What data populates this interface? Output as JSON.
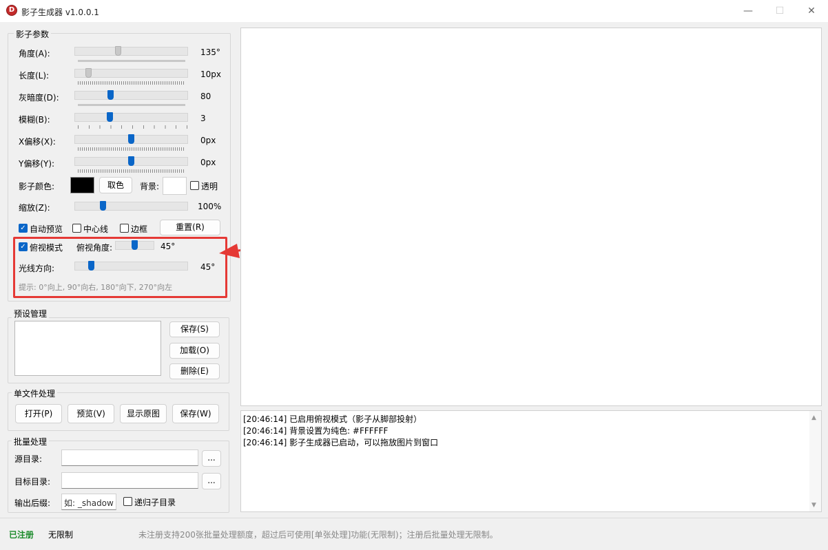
{
  "window": {
    "title": "影子生成器 v1.0.0.1",
    "app_icon_letter": "D",
    "minimize": "—",
    "maximize": "☐",
    "close": "✕"
  },
  "shadow_params": {
    "group_title": "影子参数",
    "angle": {
      "label": "角度(A):",
      "value": "135°",
      "fraction": 0.375
    },
    "length": {
      "label": "长度(L):",
      "value": "10px",
      "fraction": 0.1
    },
    "darkness": {
      "label": "灰暗度(D):",
      "value": "80",
      "fraction": 0.31
    },
    "blur": {
      "label": "模糊(B):",
      "value": "3",
      "fraction": 0.3
    },
    "offset_x": {
      "label": "X偏移(X):",
      "value": "0px",
      "fraction": 0.5
    },
    "offset_y": {
      "label": "Y偏移(Y):",
      "value": "0px",
      "fraction": 0.5
    },
    "shadow_color_label": "影子颜色:",
    "shadow_color": "#000000",
    "pick_color_button": "取色",
    "background_label": "背景:",
    "background_color": "#FFFFFF",
    "transparent_label": "透明",
    "zoom": {
      "label": "缩放(Z):",
      "value": "100%",
      "fraction": 0.24
    },
    "auto_preview_label": "自动预览",
    "center_line_label": "中心线",
    "border_label": "边框",
    "reset_button": "重置(R)",
    "topdown_mode_label": "俯视模式",
    "topdown_angle_label": "俯视角度:",
    "topdown_angle_value": "45°",
    "topdown_angle_fraction": 0.5,
    "light_direction_label": "光线方向:",
    "light_direction_value": "45°",
    "light_direction_fraction": 0.125,
    "hint": "提示: 0°向上, 90°向右, 180°向下, 270°向左"
  },
  "presets": {
    "group_title": "预设管理",
    "save_button": "保存(S)",
    "load_button": "加载(O)",
    "delete_button": "删除(E)"
  },
  "single_file": {
    "group_title": "单文件处理",
    "open_button": "打开(P)",
    "preview_button": "预览(V)",
    "show_original_button": "显示原图",
    "save_button": "保存(W)"
  },
  "batch": {
    "group_title": "批量处理",
    "source_label": "源目录:",
    "target_label": "目标目录:",
    "browse_button": "...",
    "suffix_label": "输出后缀:",
    "suffix_placeholder": "如: _shadow",
    "recursive_label": "递归子目录"
  },
  "log": {
    "lines": [
      "[20:46:14] 已启用俯视模式（影子从脚部投射）",
      "[20:46:14] 背景设置为纯色: #FFFFFF",
      "[20:46:14] 影子生成器已启动，可以拖放图片到窗口"
    ]
  },
  "status": {
    "registered": "已注册",
    "unlimited": "无限制",
    "notice": "未注册支持200张批量处理额度，超过后可使用[单张处理]功能(无限制)；注册后批量处理无限制。"
  },
  "colors": {
    "accent": "#0a66c8",
    "highlight_box": "#e53935",
    "registered_text": "#1a8a2a"
  }
}
